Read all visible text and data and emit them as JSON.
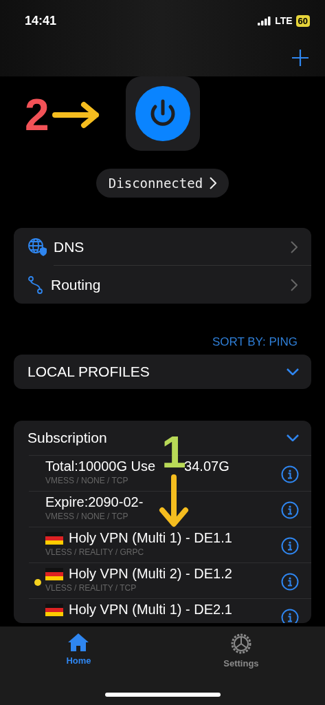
{
  "status_bar": {
    "time": "14:41",
    "network": "LTE",
    "battery": "60"
  },
  "connection": {
    "status": "Disconnected",
    "connected": false
  },
  "settings_items": [
    {
      "kind": "dns",
      "label": "DNS"
    },
    {
      "kind": "routing",
      "label": "Routing"
    }
  ],
  "sort_label": "SORT BY: PING",
  "local_profiles": {
    "title": "LOCAL PROFILES",
    "expanded": false
  },
  "subscription": {
    "title": "Subscription",
    "expanded": true,
    "profiles": [
      {
        "title": "Total:10000G Use",
        "title_end": "34.07G",
        "subtitle": "VMESS / NONE / TCP",
        "flag": false,
        "selected": false
      },
      {
        "title": "Expire:2090-02-",
        "subtitle": "VMESS / NONE / TCP",
        "flag": false,
        "selected": false
      },
      {
        "title": "Holy VPN (Multi 1) - DE1.1",
        "subtitle": "VLESS / REALITY / GRPC",
        "flag": true,
        "selected": false
      },
      {
        "title": "Holy VPN (Multi 2) - DE1.2",
        "subtitle": "VLESS / REALITY / TCP",
        "flag": true,
        "selected": true
      },
      {
        "title": "Holy VPN (Multi 1) - DE2.1",
        "flag": true,
        "selected": false
      }
    ]
  },
  "annotations": [
    {
      "label": "2",
      "color": "#f25257"
    },
    {
      "label": "1",
      "color": "#b8d957"
    }
  ],
  "tabs": [
    {
      "label": "Home",
      "selected": true
    },
    {
      "label": "Settings",
      "selected": false
    }
  ]
}
